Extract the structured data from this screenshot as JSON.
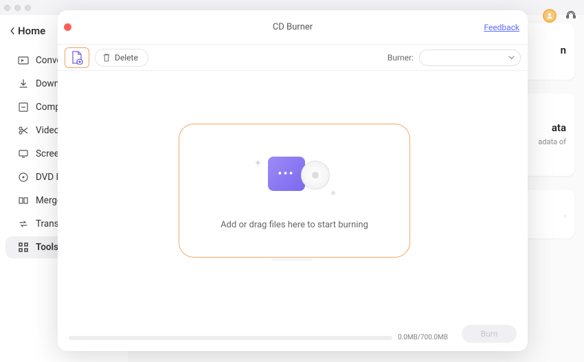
{
  "home_label": "Home",
  "sidebar": {
    "items": [
      {
        "label": "Converter"
      },
      {
        "label": "Downloader"
      },
      {
        "label": "Compressor"
      },
      {
        "label": "Video Editor"
      },
      {
        "label": "Screen Recorder"
      },
      {
        "label": "DVD Burner"
      },
      {
        "label": "Merger"
      },
      {
        "label": "Transfer"
      },
      {
        "label": "Tools"
      }
    ]
  },
  "side_cards": {
    "c1": {
      "t": "n"
    },
    "c2": {
      "t": "ata",
      "s": "adata of"
    },
    "c3": {
      "s": "."
    }
  },
  "modal": {
    "title": "CD Burner",
    "feedback": "Feedback",
    "delete_label": "Delete",
    "burner_label": "Burner:",
    "drop_text": "Add or drag files here to start burning",
    "size": "0.0MB/700.0MB",
    "burn_label": "Burn"
  }
}
